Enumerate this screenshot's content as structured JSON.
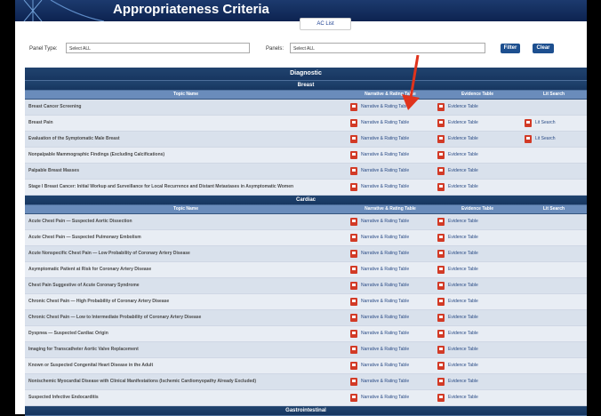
{
  "header": {
    "title": "Appropriateness Criteria",
    "logo_icon": "anatomy-logo-icon"
  },
  "ac_list_label": "AC List",
  "filters": {
    "panel_type_label": "Panel Type:",
    "panel_type_value": "Select ALL",
    "panels_label": "Panels:",
    "panels_value": "Select ALL",
    "filter_button": "Filter",
    "clear_button": "Clear"
  },
  "section_title": "Diagnostic",
  "columns": {
    "topic": "Topic Name",
    "narrative": "Narrative & Rating Table",
    "evidence": "Evidence Table",
    "lit": "Lit Search"
  },
  "links": {
    "narrative": "Narrative & Rating Table",
    "evidence": "Evidence Table",
    "lit": "Lit Search"
  },
  "groups": [
    {
      "name": "Breast",
      "rows": [
        {
          "topic": "Breast Cancer Screening",
          "lit": false
        },
        {
          "topic": "Breast Pain",
          "lit": true
        },
        {
          "topic": "Evaluation of the Symptomatic Male Breast",
          "lit": true
        },
        {
          "topic": "Nonpalpable Mammographic Findings (Excluding Calcifications)",
          "lit": false
        },
        {
          "topic": "Palpable Breast Masses",
          "lit": false
        },
        {
          "topic": "Stage I Breast Cancer: Initial Workup and Surveillance for Local Recurrence and Distant Metastases in Asymptomatic Women",
          "lit": false
        }
      ]
    },
    {
      "name": "Cardiac",
      "rows": [
        {
          "topic": "Acute Chest Pain — Suspected Aortic Dissection",
          "lit": false
        },
        {
          "topic": "Acute Chest Pain — Suspected Pulmonary Embolism",
          "lit": false
        },
        {
          "topic": "Acute Nonspecific Chest Pain — Low Probability of Coronary Artery Disease",
          "lit": false
        },
        {
          "topic": "Asymptomatic Patient at Risk for Coronary Artery Disease",
          "lit": false
        },
        {
          "topic": "Chest Pain Suggestive of Acute Coronary Syndrome",
          "lit": false
        },
        {
          "topic": "Chronic Chest Pain — High Probability of Coronary Artery Disease",
          "lit": false
        },
        {
          "topic": "Chronic Chest Pain — Low to Intermediate Probability of Coronary Artery Disease",
          "lit": false
        },
        {
          "topic": "Dyspnea — Suspected Cardiac Origin",
          "lit": false
        },
        {
          "topic": "Imaging for Transcatheter Aortic Valve Replacement",
          "lit": false
        },
        {
          "topic": "Known or Suspected Congenital Heart Disease in the Adult",
          "lit": false
        },
        {
          "topic": "Nonischemic Myocardial Disease with Clinical Manifestations (Ischemic Cardiomyopathy Already Excluded)",
          "lit": false
        },
        {
          "topic": "Suspected Infective Endocarditis",
          "lit": false
        }
      ]
    }
  ],
  "next_group": "Gastrointestinal",
  "colors": {
    "band": "#21446f",
    "header_row": "#6a8cbb",
    "pdf": "#d23a26",
    "arrow": "#e0331c"
  }
}
